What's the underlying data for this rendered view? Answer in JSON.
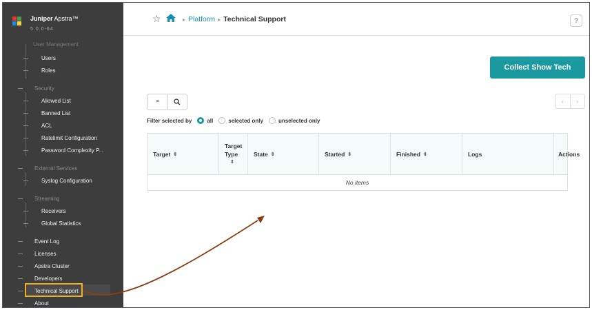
{
  "brand": {
    "name_bold": "Juniper",
    "name_rest": " Apstra™",
    "version": "5.0.0-64"
  },
  "sidebar": {
    "cut_label": "User Management",
    "items": [
      {
        "label": "Users",
        "kind": "sub"
      },
      {
        "label": "Roles",
        "kind": "sub"
      },
      {
        "label": "Security",
        "kind": "section"
      },
      {
        "label": "Allowed List",
        "kind": "sub"
      },
      {
        "label": "Banned List",
        "kind": "sub"
      },
      {
        "label": "ACL",
        "kind": "sub"
      },
      {
        "label": "Ratelimit Configuration",
        "kind": "sub"
      },
      {
        "label": "Password Complexity P...",
        "kind": "sub"
      },
      {
        "label": "External Services",
        "kind": "section"
      },
      {
        "label": "Syslog Configuration",
        "kind": "sub"
      },
      {
        "label": "Streaming",
        "kind": "section"
      },
      {
        "label": "Receivers",
        "kind": "sub"
      },
      {
        "label": "Global Statistics",
        "kind": "sub"
      },
      {
        "label": "Event Log",
        "kind": "top"
      },
      {
        "label": "Licenses",
        "kind": "top"
      },
      {
        "label": "Apstra Cluster",
        "kind": "top"
      },
      {
        "label": "Developers",
        "kind": "top"
      },
      {
        "label": "Technical Support",
        "kind": "top"
      },
      {
        "label": "About",
        "kind": "top"
      }
    ]
  },
  "header": {
    "breadcrumb": {
      "platform": "Platform",
      "current": "Technical Support"
    },
    "help": "?"
  },
  "actions": {
    "collect": "Collect Show Tech"
  },
  "toolbar": {
    "more": "•••",
    "prev": "‹",
    "next": "›"
  },
  "filter": {
    "label": "Filter selected by",
    "options": [
      "all",
      "selected only",
      "unselected only"
    ],
    "selected": "all"
  },
  "table": {
    "columns": [
      "Target",
      "Target Type",
      "State",
      "Started",
      "Finished",
      "Logs",
      "Actions"
    ],
    "sort_icon": "⇕",
    "empty_text": "No items"
  },
  "colors": {
    "accent": "#1a9aa0",
    "link": "#1b8fb8",
    "highlight": "#f2b021",
    "arrow": "#8b3e10",
    "sidebar": "#3d3d3d"
  }
}
